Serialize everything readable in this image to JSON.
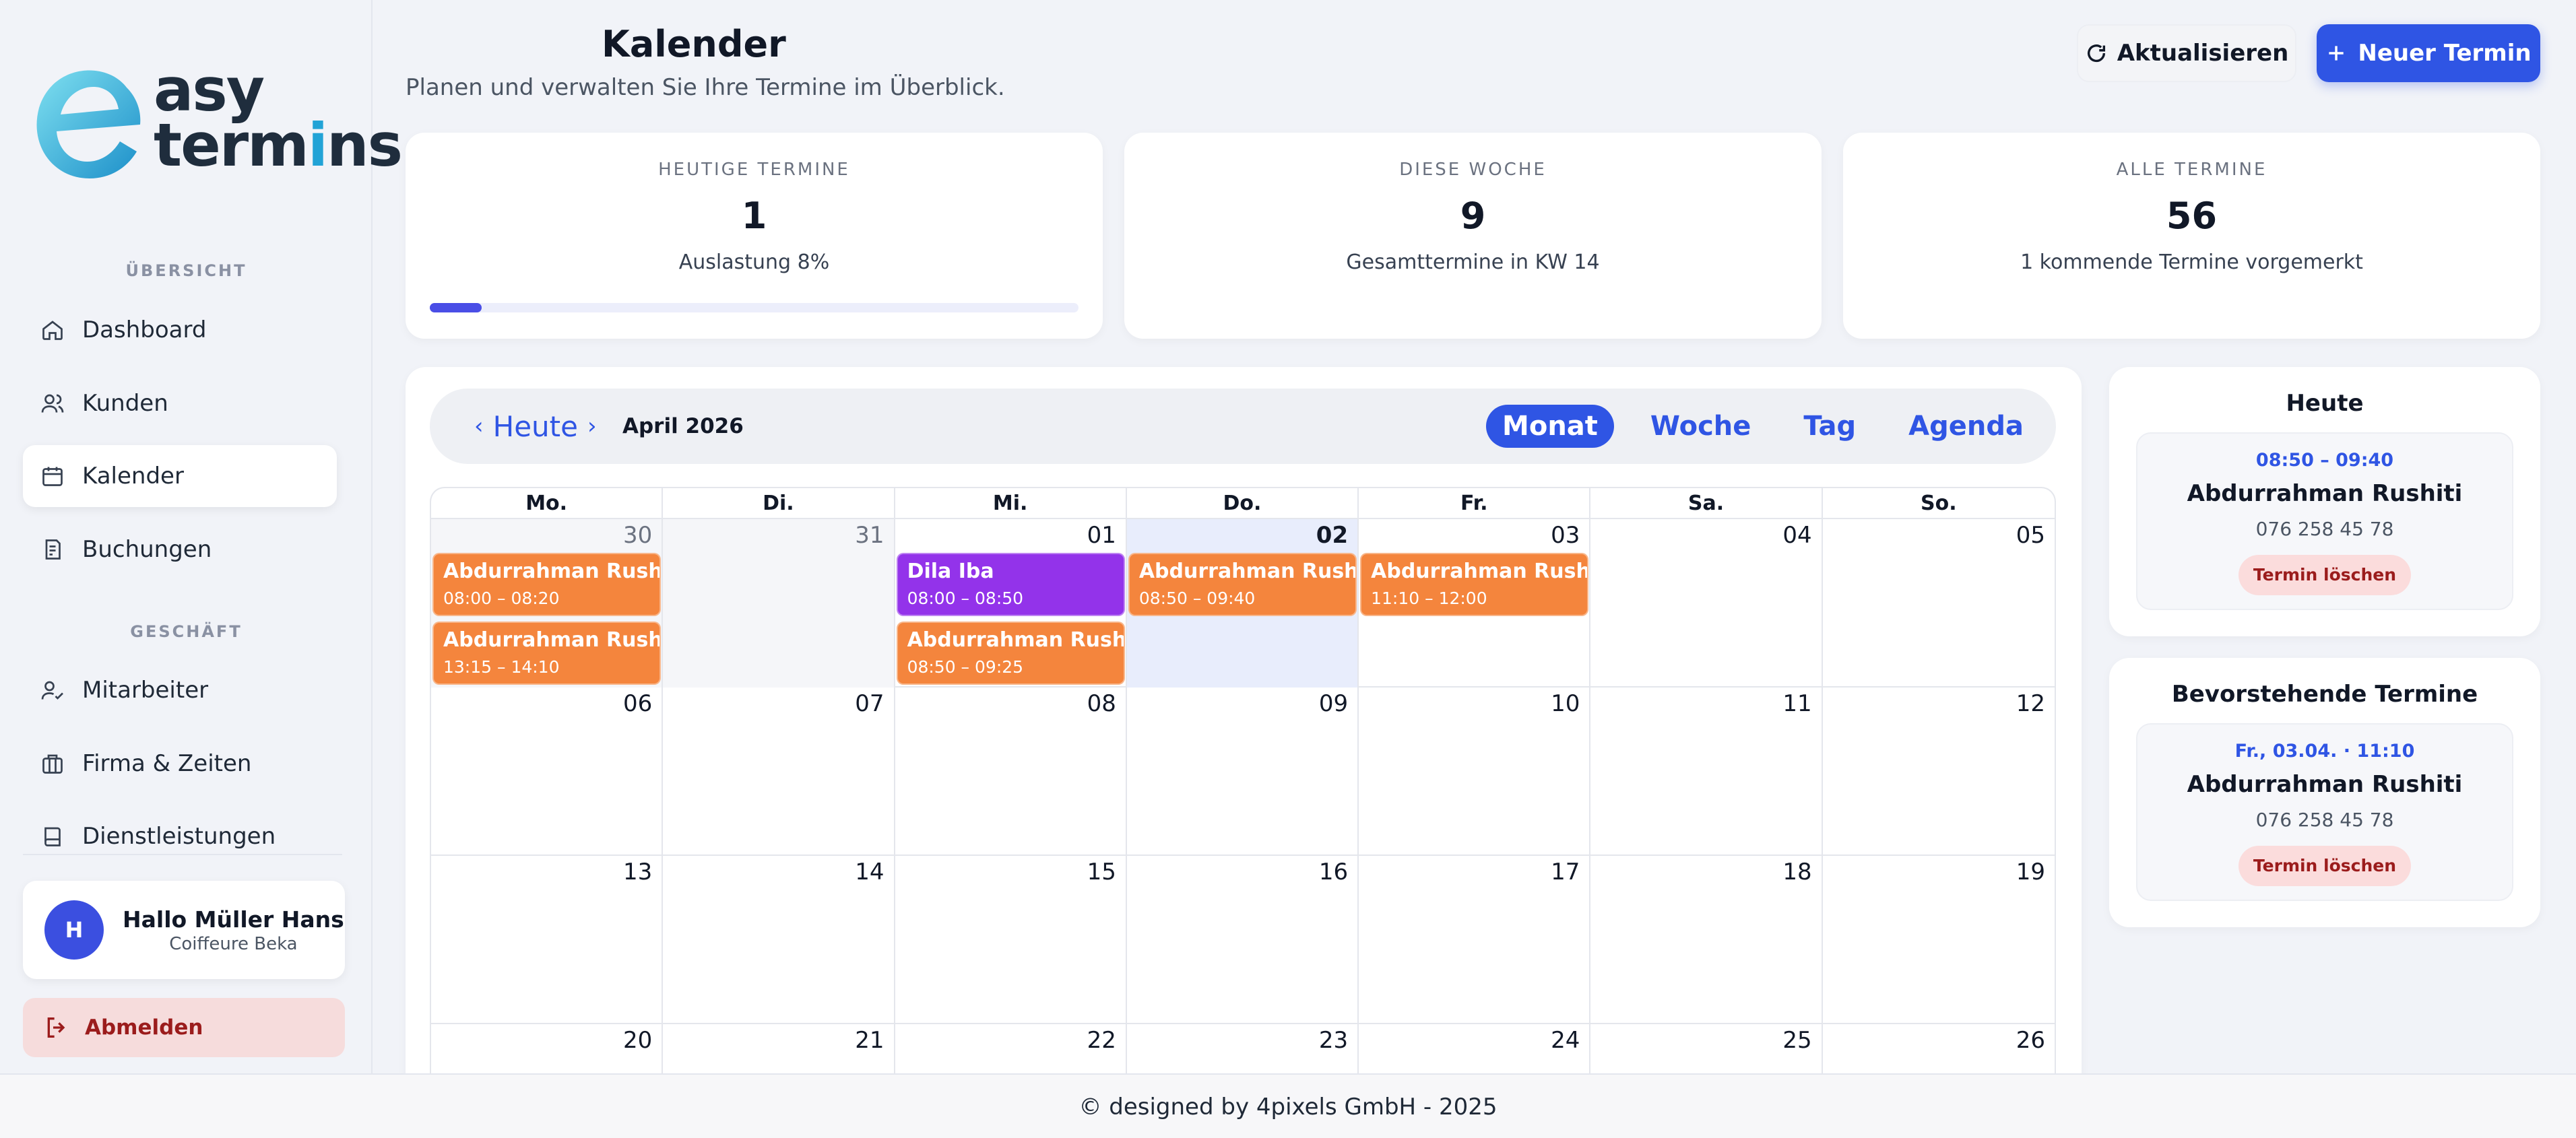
{
  "app": {
    "logo_line1": "asy",
    "logo_line2_a": "term",
    "logo_line2_b": "i",
    "logo_line2_c": "ns",
    "brand_colors": {
      "primary": "#2f55e4",
      "logo_teal": "#22a3d6",
      "event_orange": "#f4853d",
      "event_purple": "#9333ea"
    }
  },
  "sidebar": {
    "section_overview": "ÜBERSICHT",
    "section_business": "GESCHÄFT",
    "items": [
      {
        "label": "Dashboard",
        "icon": "home-icon"
      },
      {
        "label": "Kunden",
        "icon": "users-icon"
      },
      {
        "label": "Kalender",
        "icon": "calendar-icon",
        "active": true
      },
      {
        "label": "Buchungen",
        "icon": "booking-icon"
      },
      {
        "label": "Mitarbeiter",
        "icon": "user-check-icon"
      },
      {
        "label": "Firma & Zeiten",
        "icon": "briefcase-icon"
      },
      {
        "label": "Dienstleistungen",
        "icon": "book-icon"
      }
    ],
    "user": {
      "avatar_initial": "H",
      "greeting": "Hallo Müller Hans",
      "company": "Coiffeure Beka"
    },
    "logout_label": "Abmelden"
  },
  "header": {
    "title": "Kalender",
    "subtitle": "Planen und verwalten Sie Ihre Termine im Überblick.",
    "refresh_label": "Aktualisieren",
    "new_label": "Neuer Termin"
  },
  "stats": [
    {
      "label": "HEUTIGE TERMINE",
      "value": "1",
      "sub": "Auslastung 8%",
      "progress": 0.08
    },
    {
      "label": "DIESE WOCHE",
      "value": "9",
      "sub": "Gesamttermine in KW 14"
    },
    {
      "label": "ALLE TERMINE",
      "value": "56",
      "sub": "1 kommende Termine vorgemerkt"
    }
  ],
  "calendar": {
    "prev": "‹",
    "today": "Heute",
    "next": "›",
    "month": "April 2026",
    "views": [
      "Monat",
      "Woche",
      "Tag",
      "Agenda"
    ],
    "active_view": "Monat",
    "weekdays": [
      "Mo.",
      "Di.",
      "Mi.",
      "Do.",
      "Fr.",
      "Sa.",
      "So."
    ],
    "weeks": [
      [
        "30",
        "31",
        "01",
        "02",
        "03",
        "04",
        "05"
      ],
      [
        "06",
        "07",
        "08",
        "09",
        "10",
        "11",
        "12"
      ],
      [
        "13",
        "14",
        "15",
        "16",
        "17",
        "18",
        "19"
      ],
      [
        "20",
        "21",
        "22",
        "23",
        "24",
        "25",
        "26"
      ]
    ],
    "events": [
      {
        "title": "Abdurrahman Rushiti",
        "time": "08:00 – 08:20",
        "color": "orange"
      },
      {
        "title": "Abdurrahman Rushiti",
        "time": "13:15 – 14:10",
        "color": "orange"
      },
      {
        "title": "Dila Iba",
        "time": "08:00 – 08:50",
        "color": "purple"
      },
      {
        "title": "Abdurrahman Rushiti",
        "time": "08:50 – 09:25",
        "color": "orange"
      },
      {
        "title": "Abdurrahman Rushiti",
        "time": "08:50 – 09:40",
        "color": "orange"
      },
      {
        "title": "Abdurrahman Rushiti",
        "time": "11:10 – 12:00",
        "color": "orange"
      }
    ]
  },
  "today_panel": {
    "title": "Heute",
    "appointment": {
      "time": "08:50 – 09:40",
      "name": "Abdurrahman Rushiti",
      "phone": "076 258 45 78",
      "delete_label": "Termin löschen"
    }
  },
  "upcoming_panel": {
    "title": "Bevorstehende Termine",
    "appointment": {
      "time": "Fr., 03.04. · 11:10",
      "name": "Abdurrahman Rushiti",
      "phone": "076 258 45 78",
      "delete_label": "Termin löschen"
    }
  },
  "footer": {
    "text": "© designed by 4pixels GmbH - 2025"
  }
}
